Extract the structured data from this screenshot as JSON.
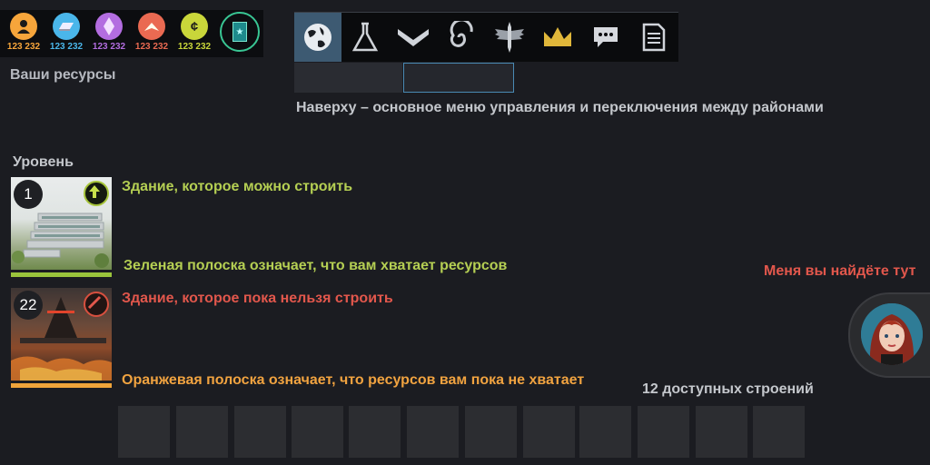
{
  "resources": [
    {
      "icon": "person-icon",
      "value": "123 232",
      "color": "#f6a53b"
    },
    {
      "icon": "ingot-icon",
      "value": "123 232",
      "color": "#4ab6ea"
    },
    {
      "icon": "crystal-icon",
      "value": "123 232",
      "color": "#b36de0"
    },
    {
      "icon": "chevron-energy-icon",
      "value": "123 232",
      "color": "#ea6a52"
    },
    {
      "icon": "credit-icon",
      "value": "123 232",
      "color": "#c9d63a"
    }
  ],
  "resources_label": "Ваши ресурсы",
  "nav": {
    "items": [
      {
        "icon": "globe-icon",
        "active": true
      },
      {
        "icon": "flask-icon",
        "active": false
      },
      {
        "icon": "chevron-down-icon",
        "active": false
      },
      {
        "icon": "spiral-icon",
        "active": false
      },
      {
        "icon": "sword-wings-icon",
        "active": false
      },
      {
        "icon": "crown-icon",
        "active": false
      },
      {
        "icon": "chat-icon",
        "active": false
      },
      {
        "icon": "document-icon",
        "active": false
      }
    ],
    "description": "Наверху – основное меню управления и переключения между районами"
  },
  "level_label": "Уровень",
  "buildings": [
    {
      "level": "1",
      "status": "buildable",
      "title": "Здание, которое можно строить",
      "bar_text": "Зеленая полоска означает, что вам хватает ресурсов",
      "bar_color": "#9bc43c"
    },
    {
      "level": "22",
      "status": "blocked",
      "title": "Здание, которое пока нельзя строить",
      "bar_text": "Оранжевая полоска означает, что ресурсов вам пока не хватает",
      "bar_color": "#f0a43a"
    }
  ],
  "available_label": "12 доступных строений",
  "slot_count": 12,
  "advisor_label": "Меня вы найдёте тут"
}
